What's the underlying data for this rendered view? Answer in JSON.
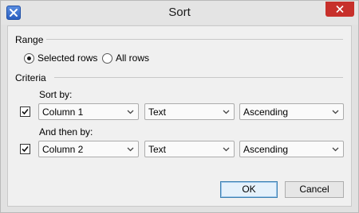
{
  "window": {
    "title": "Sort"
  },
  "range": {
    "label": "Range",
    "options": [
      {
        "label": "Selected rows",
        "selected": true
      },
      {
        "label": "All rows",
        "selected": false
      }
    ]
  },
  "criteria": {
    "label": "Criteria",
    "sort_by_label": "Sort by:",
    "then_by_label": "And then by:",
    "rows": [
      {
        "checked": true,
        "column": "Column 1",
        "type": "Text",
        "order": "Ascending"
      },
      {
        "checked": true,
        "column": "Column 2",
        "type": "Text",
        "order": "Ascending"
      }
    ]
  },
  "buttons": {
    "ok": "OK",
    "cancel": "Cancel"
  },
  "icons": {
    "app": "app-x-icon",
    "close": "close-icon",
    "dropdown": "chevron-down-icon",
    "check": "checkmark-icon"
  }
}
